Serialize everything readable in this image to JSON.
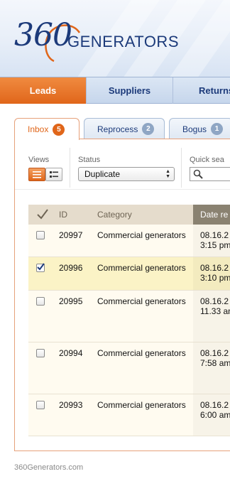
{
  "brand": {
    "logo_number": "360",
    "logo_word": "GENERATORS"
  },
  "nav": {
    "items": [
      {
        "label": "Leads",
        "active": true
      },
      {
        "label": "Suppliers",
        "active": false
      },
      {
        "label": "Returns",
        "active": false
      }
    ]
  },
  "tabs": [
    {
      "label": "Inbox",
      "count": "5",
      "active": true
    },
    {
      "label": "Reprocess",
      "count": "2",
      "active": false
    },
    {
      "label": "Bogus",
      "count": "1",
      "active": false
    }
  ],
  "filters": {
    "views_label": "Views",
    "status_label": "Status",
    "status_value": "Duplicate",
    "quick_search_label": "Quick sea",
    "quick_search_icon": "magnifier-icon"
  },
  "table": {
    "headers": {
      "check": "✓",
      "id": "ID",
      "category": "Category",
      "date": "Date re"
    },
    "rows": [
      {
        "id": "20997",
        "category": "Commercial generators",
        "date1": "08.16.2",
        "date2": "3:15 pm",
        "checked": false
      },
      {
        "id": "20996",
        "category": "Commercial generators",
        "date1": "08.16.2",
        "date2": "3:10 pm",
        "checked": true
      },
      {
        "id": "20995",
        "category": "Commercial generators",
        "date1": "08.16.2",
        "date2": "11.33 am",
        "checked": false
      },
      {
        "id": "20994",
        "category": "Commercial generators",
        "date1": "08.16.2",
        "date2": "7:58 am",
        "checked": false
      },
      {
        "id": "20993",
        "category": "Commercial generators",
        "date1": "08.16.2",
        "date2": "6:00 am",
        "checked": false
      }
    ]
  },
  "footer": {
    "text": "360Generators.com"
  },
  "colors": {
    "accent": "#e0661a",
    "brand_blue": "#1c3a7a",
    "selected_row": "#fbf3c6",
    "row_bg": "#fffbf0"
  }
}
